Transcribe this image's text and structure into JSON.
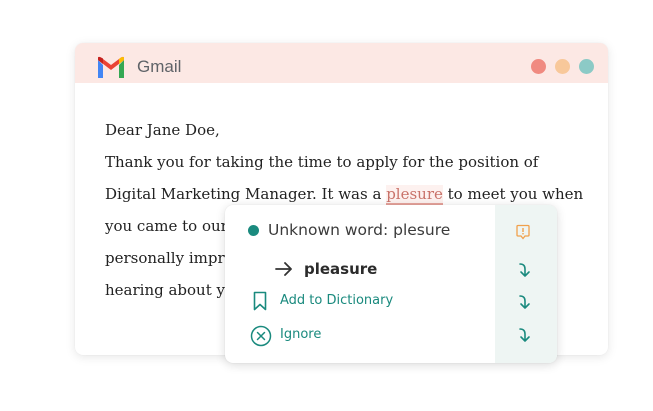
{
  "app": {
    "title": "Gmail",
    "window_controls": {
      "red": "#f08a80",
      "yellow": "#f8c89a",
      "teal": "#8ccac6"
    }
  },
  "email": {
    "greeting": "Dear Jane Doe,",
    "line1": "Thank you for taking the time to apply for the position of",
    "line2_before": "Digital Marketing Manager. It was a ",
    "line2_misspelled": "plesure",
    "line2_after": " to meet you when",
    "line3": "you came to our",
    "line4": "personally impr",
    "line5": "hearing about yo"
  },
  "popup": {
    "unknown_label": "Unknown word: plesure",
    "suggestion": "pleasure",
    "add_to_dictionary": "Add to Dictionary",
    "ignore": "Ignore",
    "accent_color": "#1a8a7e",
    "warning_color": "#f0a04b",
    "icons": {
      "status": "status-dot-icon",
      "info": "info-icon",
      "suggestion": "arrow-right-icon",
      "dictionary": "bookmark-icon",
      "ignore": "circle-x-icon",
      "apply": "arrow-down-right-icon"
    }
  }
}
